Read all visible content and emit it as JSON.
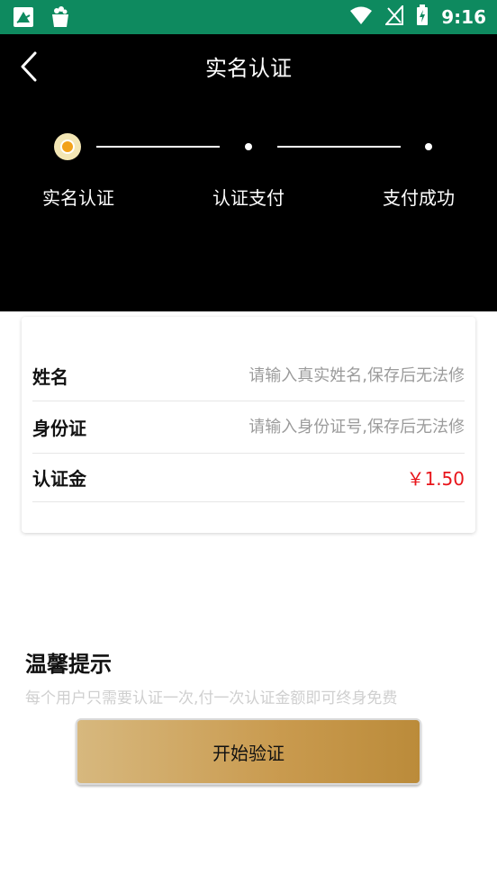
{
  "status_bar": {
    "time": "9:16",
    "icons": [
      "app-icon-1",
      "shopping-bag-icon",
      "wifi-icon",
      "signal-icon",
      "battery-icon"
    ]
  },
  "header": {
    "title": "实名认证",
    "back_icon": "chevron-left-icon",
    "background": "#000000"
  },
  "steps": [
    {
      "label": "实名认证",
      "active": true
    },
    {
      "label": "认证支付",
      "active": false
    },
    {
      "label": "支付成功",
      "active": false
    }
  ],
  "form": {
    "name_label": "姓名",
    "name_placeholder": "请输入真实姓名,保存后无法修",
    "id_label": "身份证",
    "id_placeholder": "请输入身份证号,保存后无法修",
    "fee_label": "认证金",
    "fee_value": "￥1.50"
  },
  "tips": {
    "title": "温馨提示",
    "text": "每个用户只需要认证一次,付一次认证金额即可终身免费"
  },
  "action": {
    "start_label": "开始验证"
  },
  "colors": {
    "status_bar": "#0e8a5f",
    "accent_gold": "#c99a4e",
    "price_red": "#e8141a",
    "active_step": "#f2a21c"
  }
}
